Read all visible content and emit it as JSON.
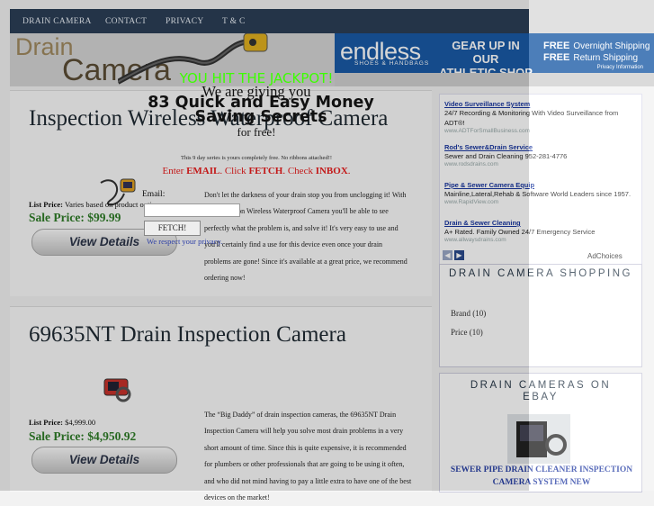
{
  "nav": {
    "items": [
      "DRAIN CAMERA",
      "CONTACT",
      "PRIVACY",
      "T & C"
    ]
  },
  "header": {
    "brand_line1": "Drain",
    "brand_line2": "Camera"
  },
  "top_ad": {
    "logo": "endless",
    "logo_sub": "SHOES & HANDBAGS",
    "headline_line1": "GEAR UP IN OUR",
    "headline_line2": "ATHLETIC SHOP",
    "free_label": "FREE",
    "free1": "Overnight Shipping",
    "free2": "Return Shipping",
    "info": "Privacy Information",
    "bg_color": "#1a5aa6"
  },
  "products": [
    {
      "title": "Inspection Wireless Waterproof Camera",
      "list_price_label": "List Price:",
      "list_price": "Varies based on product options",
      "sale_price": "Sale Price: $99.99",
      "button_label": "View Details",
      "description": "Don't let the darkness of your drain stop you from unclogging it! With the Inspection Wireless Waterproof Camera you'll be able to see perfectly what the problem is, and solve it! It's very easy to use and you'll certainly find a use for this device even once your drain problems are gone! Since it's available at a great price, we recommend ordering now!"
    },
    {
      "title": "69635NT Drain Inspection Camera",
      "list_price_label": "List Price:",
      "list_price": "$4,999.00",
      "sale_price": "Sale Price: $4,950.92",
      "button_label": "View Details",
      "description": "The “Big Daddy” of drain inspection cameras, the 69635NT Drain Inspection Camera will help you solve most drain problems in a very short amount of time. Since this is quite expensive, it is recommended for plumbers or other professionals that are going to be using it often, and who did not mind having to pay a little extra to have one of the best devices on the market!"
    }
  ],
  "sidebar_ads": [
    {
      "title": "Video Surveillance System",
      "line": "24/7 Recording & Monitoring With Video Surveillance from ADT®!",
      "url": "www.ADTForSmallBusiness.com"
    },
    {
      "title": "Rod's Sewer&Drain Service",
      "line": "Sewer and Drain Cleaning 952-281-4776",
      "url": "www.rodsdrains.com"
    },
    {
      "title": "Pipe & Sewer Camera Equip",
      "line": "Mainline,Lateral,Rehab & Software World Leaders since 1957.",
      "url": "www.RapidView.com"
    },
    {
      "title": "Drain & Sewer Cleaning",
      "line": "A+ Rated. Family Owned 24/7 Emergency Service",
      "url": "www.allwaysdrains.com"
    }
  ],
  "adchoices": "AdChoices",
  "shopping": {
    "title": "DRAIN CAMERA SHOPPING",
    "links": [
      "Brand (10)",
      "Price (10)"
    ]
  },
  "ebay": {
    "title": "DRAIN CAMERAS ON EBAY",
    "item": "SEWER PIPE DRAIN CLEANER INSPECTION CAMERA SYSTEM NEW"
  },
  "popup": {
    "jackpot": "YOU HIT THE JACKPOT!",
    "giving": "We are giving you",
    "secret": "83 Quick and Easy Money Saving Secrets",
    "free": "for free!",
    "series": "This 9 day series is yours completely free. No ribbons attached!!",
    "enter_prefix": "Enter ",
    "enter_email": "EMAIL",
    "enter_mid": ". Click ",
    "enter_fetch": "FETCH",
    "enter_mid2": ". Check ",
    "enter_inbox": "INBOX",
    "enter_end": ".",
    "email_label": "Email:",
    "email_value": "",
    "fetch_button": "FETCH!",
    "privacy": "We respect your privacy."
  }
}
